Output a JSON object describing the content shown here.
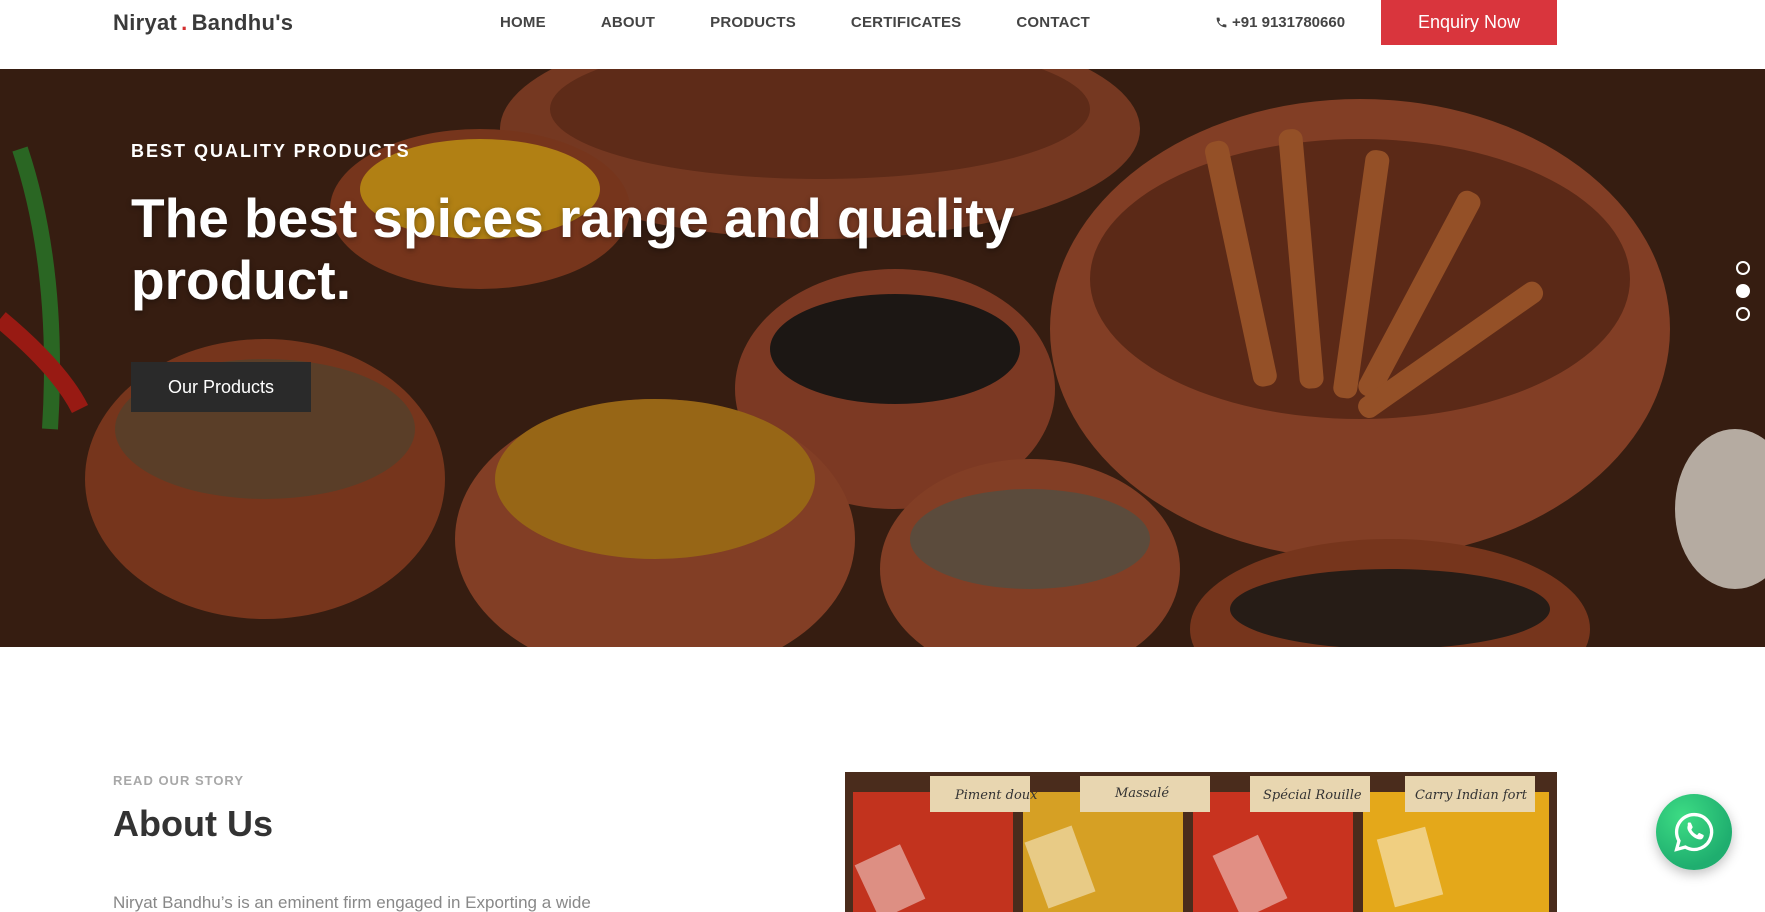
{
  "header": {
    "logo_part1": "Niryat",
    "logo_dot": ".",
    "logo_part2": "Bandhu's",
    "nav": [
      "HOME",
      "ABOUT",
      "PRODUCTS",
      "CERTIFICATES",
      "CONTACT"
    ],
    "phone": "+91 9131780660",
    "enquiry_label": "Enquiry Now",
    "accent_color": "#d9353d"
  },
  "hero": {
    "eyebrow": "BEST QUALITY PRODUCTS",
    "title": "The best spices range and quality product.",
    "button_label": "Our Products",
    "slides_count": 3,
    "active_slide": 2
  },
  "about": {
    "eyebrow": "READ OUR STORY",
    "title": "About Us",
    "text": "Niryat Bandhu’s is an eminent firm engaged in Exporting a wide",
    "image_labels": [
      "Piment doux",
      "Massalé",
      "Spécial Rouille",
      "Carry Indian fort"
    ]
  },
  "icons": {
    "phone": "phone-icon",
    "whatsapp": "whatsapp-icon"
  }
}
